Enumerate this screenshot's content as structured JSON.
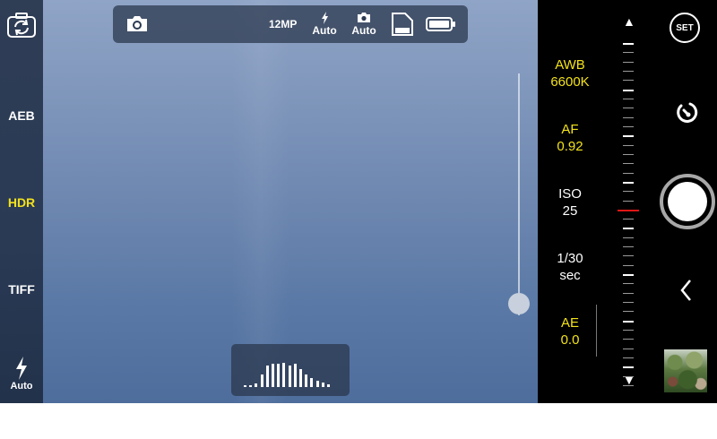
{
  "left_bar": {
    "switch_camera_icon": "camera-rotate-icon",
    "aeb_label": "AEB",
    "hdr_label": "HDR",
    "tiff_label": "TIFF",
    "flash_icon": "lightning-icon",
    "flash_label": "Auto",
    "active_color": "#f3e21a"
  },
  "top_bar": {
    "camera_mode_icon": "camera-icon",
    "resolution": "12MP",
    "flash_label": "Auto",
    "capture_label": "Auto",
    "storage_icon": "sd-card-icon",
    "battery_icon": "battery-icon"
  },
  "histogram": {
    "levels": [
      0.05,
      0.05,
      0.12,
      0.4,
      0.7,
      0.75,
      0.75,
      0.8,
      0.7,
      0.75,
      0.6,
      0.4,
      0.3,
      0.2,
      0.15,
      0.1
    ]
  },
  "zoom": {
    "level": 0.05
  },
  "params": {
    "awb_label": "AWB",
    "awb_value": "6600K",
    "af_label": "AF",
    "af_value": "0.92",
    "iso_label": "ISO",
    "iso_value": "25",
    "shutter_label": "1/30",
    "shutter_unit": "sec",
    "ae_label": "AE",
    "ae_value": "0.0"
  },
  "controls": {
    "set_label": "SET",
    "timer_icon": "self-timer-icon",
    "back_icon": "chevron-left-icon",
    "up_arrow": "▲",
    "down_arrow": "▼"
  }
}
